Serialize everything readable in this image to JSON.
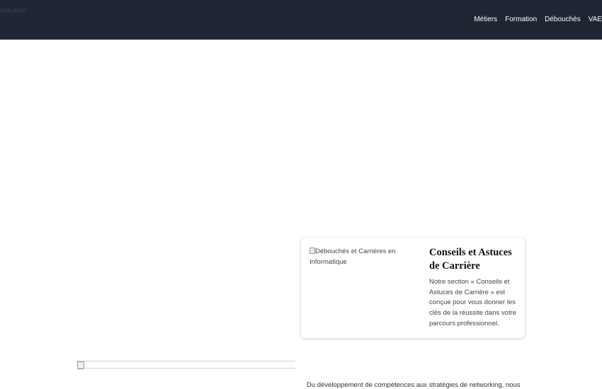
{
  "header": {
    "logo_text": "leduweb",
    "nav": [
      "Métiers",
      "Formation",
      "Débouchés",
      "VAE"
    ]
  },
  "card": {
    "image_alt": "Débouchés et Carrières en Informatique",
    "title": "Conseils et Astuces de Carrière",
    "text": "Notre section « Conseils et Astuces de Carrière » est conçue pour vous donner les clés de la réussite dans votre parcours professionnel."
  },
  "intro_text": "Du développement de compétences aux stratégies de networking, nous",
  "colors": {
    "header_bg": "#1e2533",
    "nav_text": "#ffffff"
  }
}
